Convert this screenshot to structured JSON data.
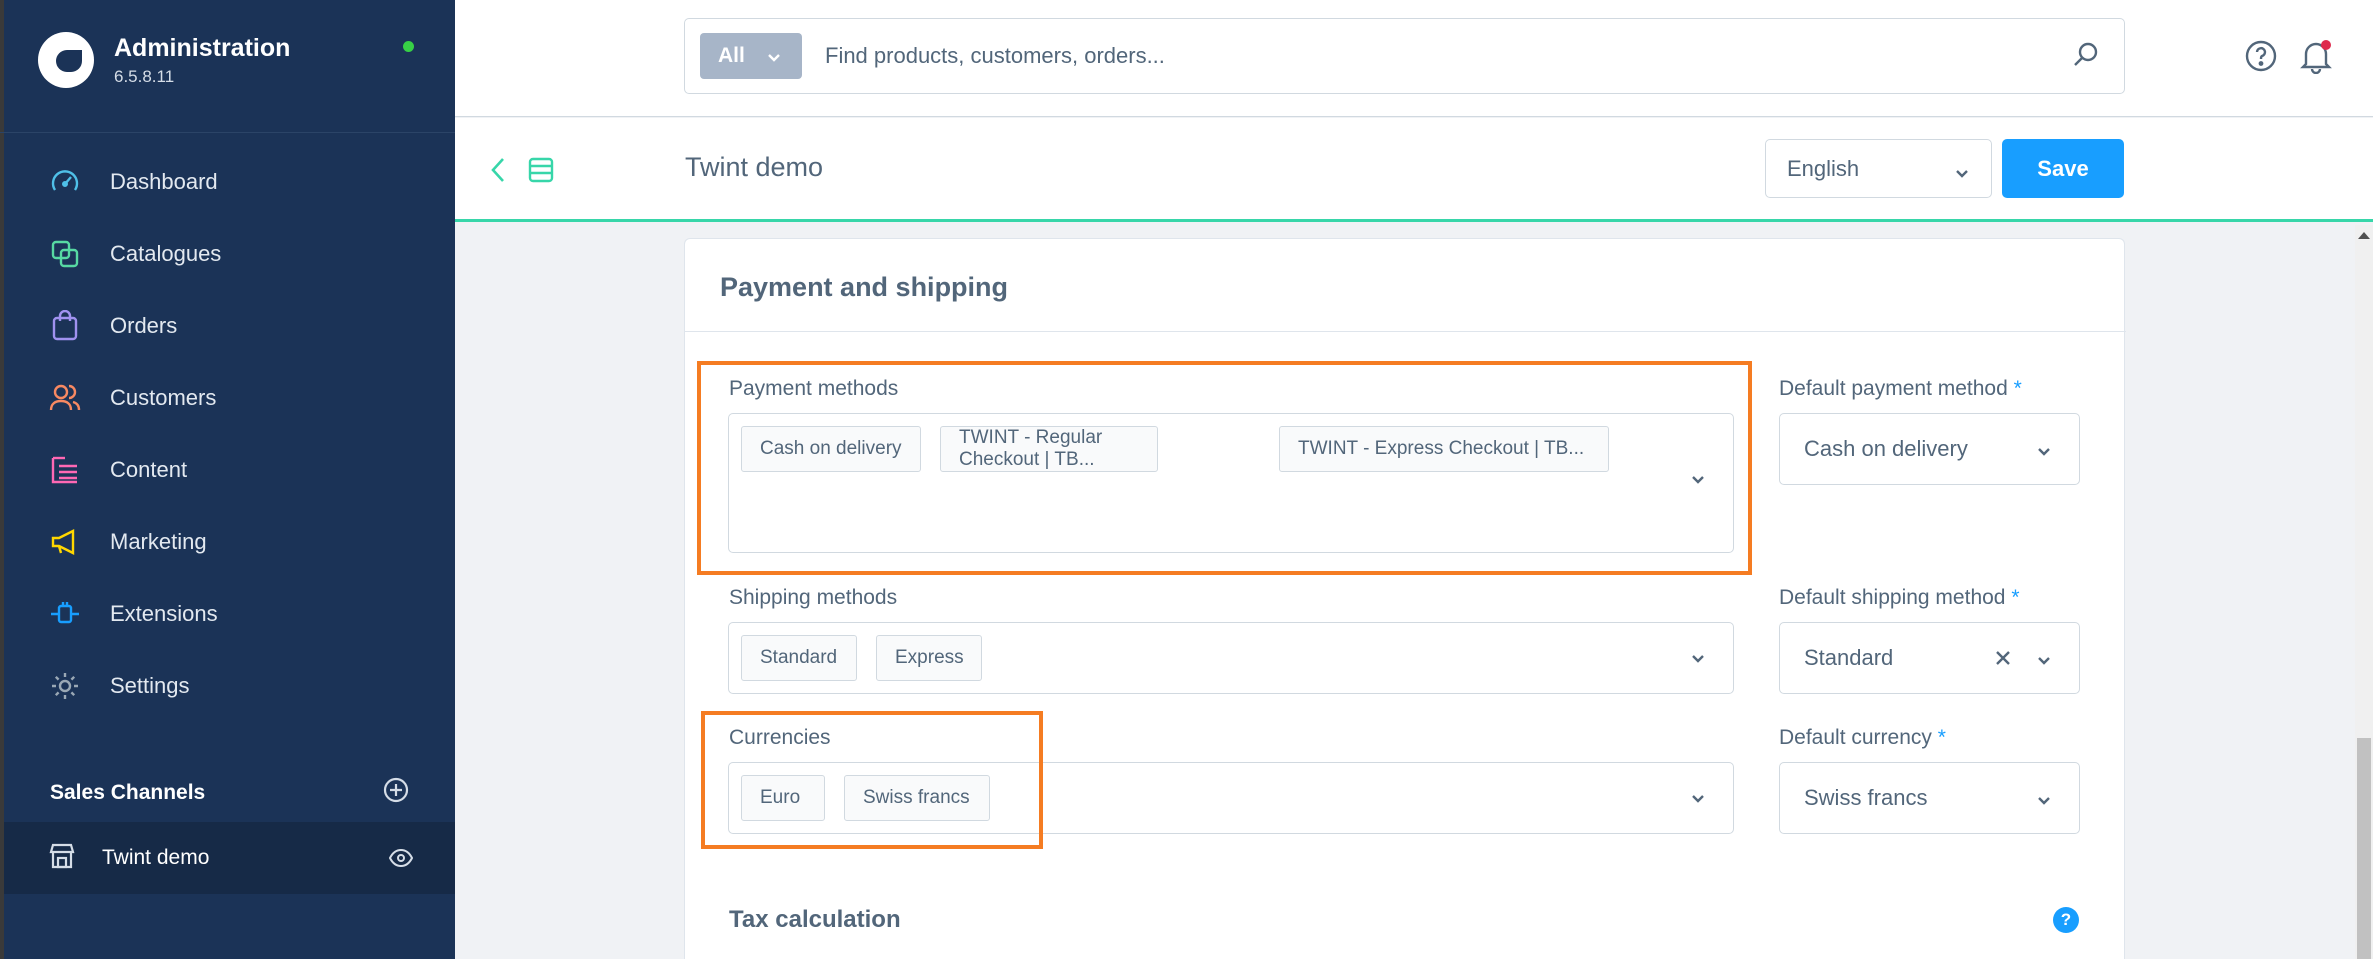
{
  "app": {
    "title": "Administration",
    "version": "6.5.8.11"
  },
  "nav": {
    "items": [
      {
        "label": "Dashboard",
        "icon": "dashboard-icon",
        "color": "#4fc0e8"
      },
      {
        "label": "Catalogues",
        "icon": "catalogues-icon",
        "color": "#57d9a3"
      },
      {
        "label": "Orders",
        "icon": "orders-icon",
        "color": "#a092f0"
      },
      {
        "label": "Customers",
        "icon": "customers-icon",
        "color": "#f88962"
      },
      {
        "label": "Content",
        "icon": "content-icon",
        "color": "#ff68b4"
      },
      {
        "label": "Marketing",
        "icon": "marketing-icon",
        "color": "#ffd700"
      },
      {
        "label": "Extensions",
        "icon": "extensions-icon",
        "color": "#189eff"
      },
      {
        "label": "Settings",
        "icon": "settings-icon",
        "color": "#9aa8b5"
      }
    ]
  },
  "sales_channels": {
    "title": "Sales Channels",
    "items": [
      {
        "label": "Twint demo"
      }
    ]
  },
  "search": {
    "type_label": "All",
    "placeholder": "Find products, customers, orders..."
  },
  "page": {
    "title": "Twint demo",
    "language": "English",
    "save_label": "Save"
  },
  "card": {
    "title": "Payment and shipping",
    "payment_methods": {
      "label": "Payment methods",
      "tags": [
        "Cash on delivery",
        "TWINT - Regular Checkout | TB...",
        "TWINT - Express Checkout | TB..."
      ]
    },
    "default_payment": {
      "label": "Default payment method",
      "required_mark": "*",
      "value": "Cash on delivery"
    },
    "shipping_methods": {
      "label": "Shipping methods",
      "tags": [
        "Standard",
        "Express"
      ]
    },
    "default_shipping": {
      "label": "Default shipping method",
      "required_mark": "*",
      "value": "Standard"
    },
    "currencies": {
      "label": "Currencies",
      "tags": [
        "Euro",
        "Swiss francs"
      ]
    },
    "default_currency": {
      "label": "Default currency",
      "required_mark": "*",
      "value": "Swiss francs"
    },
    "tax_title": "Tax calculation",
    "tax_help": "?"
  },
  "colors": {
    "sidebar": "#1b3357",
    "accent": "#189eff",
    "highlight": "#f57c22",
    "online": "#37d046"
  }
}
